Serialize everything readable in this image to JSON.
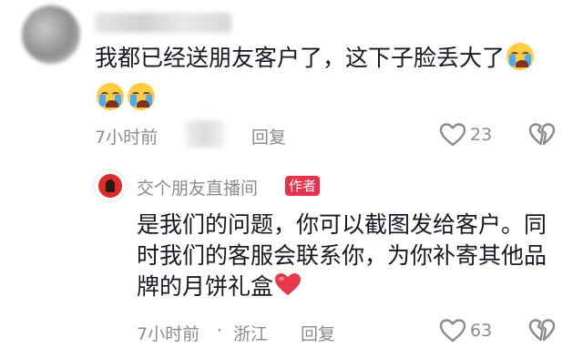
{
  "comment": {
    "text": "我都已经送朋友客户了，这下子脸丢大了",
    "emoji_names": [
      "crying-face-emoji",
      "crying-face-emoji",
      "crying-face-emoji"
    ],
    "time": "7小时前",
    "reply_label": "回复",
    "like_count": "23"
  },
  "reply": {
    "author": "交个朋友直播间",
    "badge": "作者",
    "lines": [
      "是我们的问题，你可以截图发给客户。同",
      "时我们的客服会联系你，为你补寄其他品",
      "牌的月饼礼盒"
    ],
    "emoji_name": "red-heart-emoji",
    "time": "7小时前",
    "separator": "·",
    "location": "浙江",
    "reply_label": "回复",
    "like_count": "63"
  },
  "colors": {
    "text": "#161823",
    "meta": "#8a8b91",
    "badge_bg": "#e9304d",
    "heart": "#e8394b"
  }
}
